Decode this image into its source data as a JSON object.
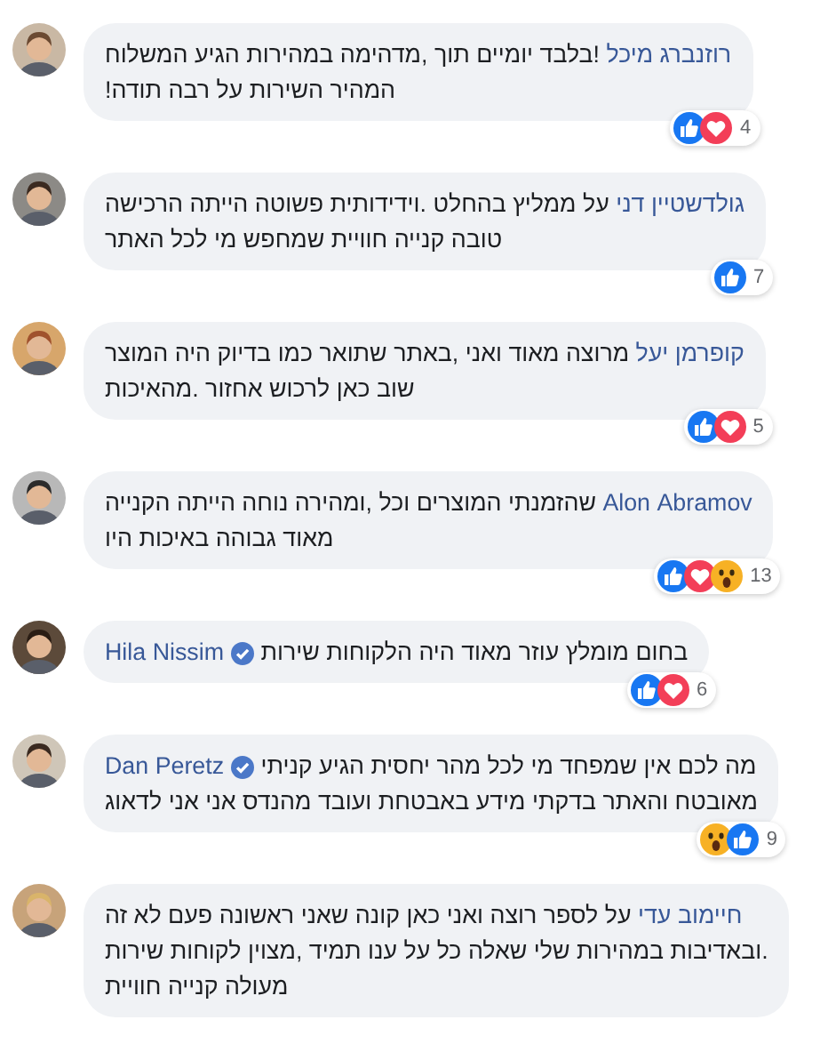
{
  "comments": [
    {
      "lines": [
        [
          {
            "kind": "name",
            "text": "מיכל רוזנברג",
            "verified": false
          },
          {
            "kind": "text",
            "text": "המשלוח הגיע במהירות מדהימה, תוך יומיים בלבד!"
          }
        ],
        [
          {
            "kind": "text",
            "text": "!תודה רבה על השירות המהיר"
          }
        ]
      ],
      "reactions": [
        {
          "kind": "like"
        },
        {
          "kind": "love"
        }
      ],
      "count": "4"
    },
    {
      "lines": [
        [
          {
            "kind": "name",
            "text": "דני גולדשטיין",
            "verified": false
          },
          {
            "kind": "text",
            "text": "הרכישה הייתה פשוטה וידידותית. בהחלט ממליץ על"
          }
        ],
        [
          {
            "kind": "text",
            "text": "האתר לכל מי שמחפש חוויית קנייה טובה"
          }
        ]
      ],
      "reactions": [
        {
          "kind": "like"
        }
      ],
      "count": "7"
    },
    {
      "lines": [
        [
          {
            "kind": "name",
            "text": "יעל קופרמן",
            "verified": false
          },
          {
            "kind": "text",
            "text": "המוצר היה בדיוק כמו שתואר באתר, ואני מאוד מרוצה"
          }
        ],
        [
          {
            "kind": "text",
            "text": "מהאיכות. אחזור לרכוש כאן שוב"
          }
        ]
      ],
      "reactions": [
        {
          "kind": "like"
        },
        {
          "kind": "love"
        }
      ],
      "count": "5"
    },
    {
      "lines": [
        [
          {
            "kind": "name",
            "text": "Alon Abramov",
            "verified": false
          },
          {
            "kind": "text",
            "text": "הקנייה הייתה נוחה ומהירה, וכל המוצרים שהזמנתי"
          }
        ],
        [
          {
            "kind": "text",
            "text": "היו באיכות גבוהה מאוד"
          }
        ]
      ],
      "reactions": [
        {
          "kind": "like"
        },
        {
          "kind": "love"
        },
        {
          "kind": "wow"
        }
      ],
      "count": "13"
    },
    {
      "lines": [
        [
          {
            "kind": "text",
            "text": "שירות הלקוחות היה מאוד עוזר מומלץ בחום"
          },
          {
            "kind": "name",
            "text": "Hila Nissim",
            "verified": true
          }
        ]
      ],
      "reactions": [
        {
          "kind": "like"
        },
        {
          "kind": "love"
        }
      ],
      "count": "6"
    },
    {
      "lines": [
        [
          {
            "kind": "text",
            "text": "קניתי הגיע יחסית מהר לכל מי שמפחד אין לכם מה"
          },
          {
            "kind": "name",
            "text": "Dan Peretz",
            "verified": true
          }
        ],
        [
          {
            "kind": "text",
            "text": "לדאוג אני אני מהנדס ועובד באבטחת מידע בדקתי והאתר מאובטח"
          }
        ]
      ],
      "reactions": [
        {
          "kind": "wow"
        },
        {
          "kind": "like"
        }
      ],
      "count": "9"
    },
    {
      "lines": [
        [
          {
            "kind": "name",
            "text": "עדי חיימוב",
            "verified": false
          },
          {
            "kind": "text",
            "text": "זה לא פעם ראשונה שאני קונה כאן ואני רוצה לספר על"
          }
        ],
        [
          {
            "kind": "text",
            "text": "שירות לקוחות מצוין, תמיד ענו על כל שאלה שלי במהירות ובאדיבות."
          }
        ],
        [
          {
            "kind": "text",
            "text": "חוויית קנייה מעולה"
          }
        ]
      ]
    }
  ]
}
